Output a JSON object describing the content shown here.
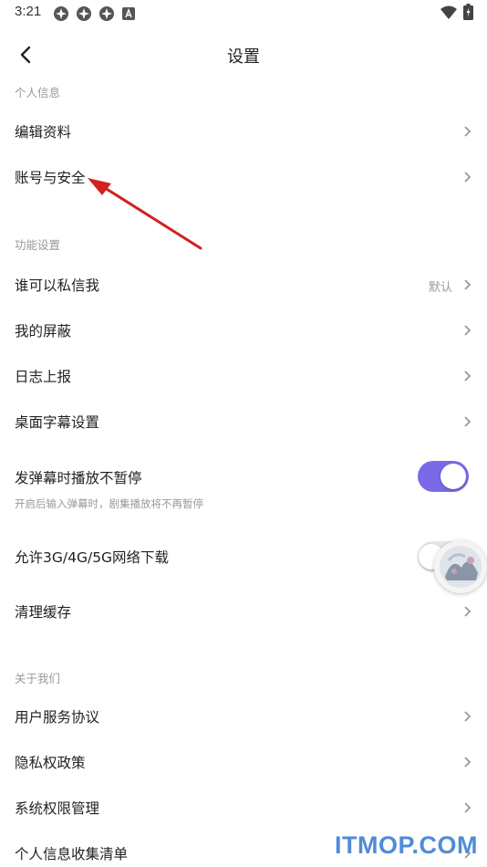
{
  "status_bar": {
    "time": "3:21",
    "notification_icons": [
      "app-icon",
      "app-icon",
      "app-icon",
      "a-icon"
    ],
    "system_icons": [
      "wifi-icon",
      "battery-icon"
    ]
  },
  "header": {
    "title": "设置",
    "back_icon": "chevron-left-icon"
  },
  "sections": {
    "personal": "个人信息",
    "function": "功能设置",
    "about": "关于我们"
  },
  "items": {
    "edit_profile": "编辑资料",
    "account_security": "账号与安全",
    "who_can_message": "谁可以私信我",
    "who_can_message_value": "默认",
    "my_blocked": "我的屏蔽",
    "log_report": "日志上报",
    "desktop_subtitle": "桌面字幕设置",
    "danmaku_no_pause": "发弹幕时播放不暂停",
    "danmaku_no_pause_desc": "开启后输入弹幕时，剧集播放将不再暂停",
    "allow_mobile_download": "允许3G/4G/5G网络下载",
    "clear_cache": "清理缓存",
    "user_agreement": "用户服务协议",
    "privacy_policy": "隐私权政策",
    "permission_mgmt": "系统权限管理",
    "personal_info_list": "个人信息收集清单"
  },
  "toggles": {
    "danmaku_no_pause": true,
    "allow_mobile_download": false
  },
  "colors": {
    "accent": "#7b6ae8",
    "annotation_arrow": "#d42020",
    "watermark": "#4f8cd6"
  },
  "watermark": "ITMOP.COM"
}
